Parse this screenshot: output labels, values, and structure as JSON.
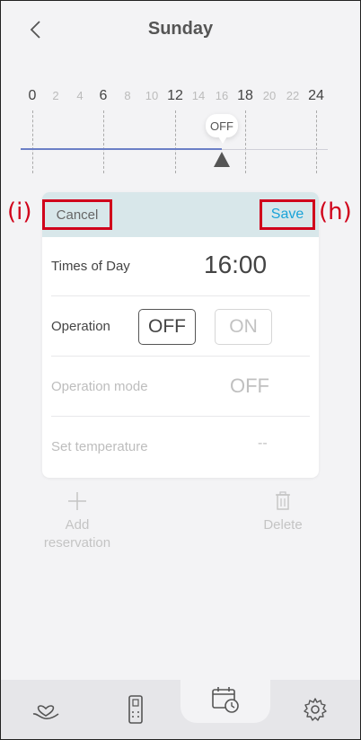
{
  "header": {
    "title": "Sunday"
  },
  "timeline": {
    "ticks": [
      "0",
      "2",
      "4",
      "6",
      "8",
      "10",
      "12",
      "14",
      "16",
      "18",
      "20",
      "22",
      "24"
    ],
    "marker_label": "OFF"
  },
  "panel": {
    "cancel_label": "Cancel",
    "save_label": "Save",
    "times_of_day_label": "Times of Day",
    "times_of_day_value": "16:00",
    "operation_label": "Operation",
    "operation_off": "OFF",
    "operation_on": "ON",
    "operation_mode_label": "Operation mode",
    "operation_mode_value": "OFF",
    "set_temperature_label": "Set temperature",
    "set_temperature_value": "--"
  },
  "annotations": {
    "cancel_badge": "(i)",
    "save_badge": "(h)"
  },
  "actions": {
    "add_label": "Add reservation",
    "delete_label": "Delete"
  },
  "bottom_nav": {
    "items": [
      "care-icon",
      "remote-icon",
      "schedule-icon",
      "settings-icon"
    ],
    "active_index": 2
  },
  "colors": {
    "accent": "#1aa3d8",
    "bar": "#d8e7ea",
    "timeline": "#6b7fc6",
    "highlight": "#d0021b"
  }
}
